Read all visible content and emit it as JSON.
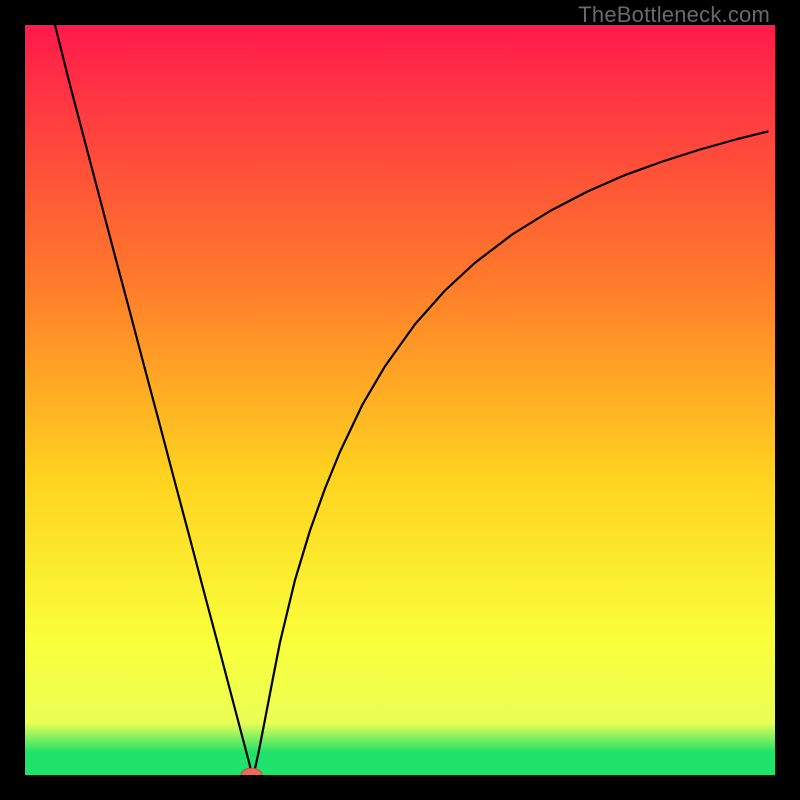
{
  "watermark": {
    "text": "TheBottleneck.com"
  },
  "colors": {
    "bg_black": "#000000",
    "grad_top": "#ff1a4b",
    "grad_mid1": "#ff7a2a",
    "grad_mid2": "#ffd21f",
    "grad_mid3": "#f9ff3a",
    "grad_bottom_y": "#eaff55",
    "grad_green": "#1fe26a",
    "curve": "#000000",
    "marker_fill": "#e56a5f",
    "marker_stroke": "#c94a3f"
  },
  "chart_data": {
    "type": "line",
    "title": "",
    "xlabel": "",
    "ylabel": "",
    "xlim": [
      0,
      100
    ],
    "ylim": [
      0,
      100
    ],
    "annotations": [],
    "series": [
      {
        "name": "bottleneck-curve",
        "x": [
          4,
          6,
          8,
          10,
          12,
          14,
          16,
          18,
          20,
          22,
          24,
          26,
          28,
          29,
          30,
          30.2,
          30.7,
          31.2,
          32,
          33,
          34,
          36,
          38,
          40,
          42,
          45,
          48,
          52,
          56,
          60,
          65,
          70,
          75,
          80,
          85,
          90,
          95,
          99
        ],
        "y": [
          100,
          92,
          84.4,
          76.8,
          69.2,
          61.7,
          54.1,
          46.6,
          39.0,
          31.5,
          23.9,
          16.4,
          8.8,
          5.0,
          1.2,
          0.0,
          1.0,
          3.3,
          7.4,
          12.6,
          17.7,
          26.0,
          32.6,
          38.2,
          43.1,
          49.4,
          54.5,
          60.1,
          64.6,
          68.3,
          72.1,
          75.2,
          77.8,
          80.0,
          81.8,
          83.4,
          84.8,
          85.8
        ]
      }
    ],
    "marker": {
      "x": 30.2,
      "y": 0.0,
      "rx": 1.4,
      "ry": 0.9
    }
  }
}
